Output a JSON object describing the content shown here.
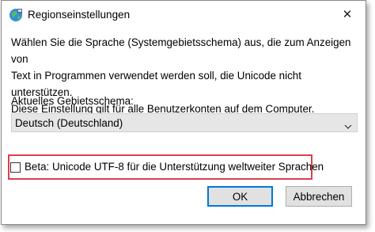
{
  "window": {
    "title": "Regionseinstellungen",
    "icon": "globe-icon",
    "close_symbol": "✕"
  },
  "content": {
    "description_lines": [
      "Wählen Sie die Sprache (Systemgebietsschema) aus, die zum Anzeigen von",
      "Text in Programmen verwendet werden soll, die Unicode nicht unterstützen.",
      "Diese Einstellung gilt für alle Benutzerkonten auf dem Computer."
    ],
    "locale_label": "Aktuelles Gebietsschema:",
    "locale_value": "Deutsch (Deutschland)",
    "utf8_checkbox_label": "Beta: Unicode UTF-8 für die Unterstützung weltweiter Sprachen",
    "utf8_checked": false
  },
  "buttons": {
    "ok_label": "OK",
    "cancel_label": "Abbrechen"
  },
  "colors": {
    "highlight": "#d9404d",
    "default_button_border": "#0078d7"
  }
}
